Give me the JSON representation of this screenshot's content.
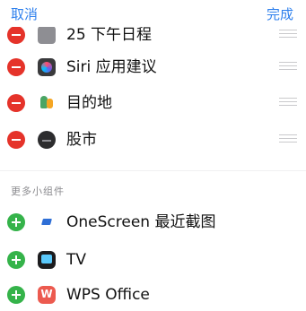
{
  "header": {
    "cancel_label": "取消",
    "done_label": "完成"
  },
  "active_widgets": [
    {
      "label": "25 下午日程",
      "icon": "calendar-icon"
    },
    {
      "label": "Siri 应用建议",
      "icon": "siri-icon"
    },
    {
      "label": "目的地",
      "icon": "destination-icon"
    },
    {
      "label": "股市",
      "icon": "stocks-icon"
    }
  ],
  "more_widgets": {
    "section_title": "更多小组件",
    "items": [
      {
        "label": "OneScreen 最近截图",
        "icon": "onescreen-icon"
      },
      {
        "label": "TV",
        "icon": "tv-icon"
      },
      {
        "label": "WPS Office",
        "icon": "wps-icon"
      }
    ]
  },
  "colors": {
    "accent": "#2f80ed",
    "remove": "#e5332a",
    "add": "#35b34a"
  }
}
